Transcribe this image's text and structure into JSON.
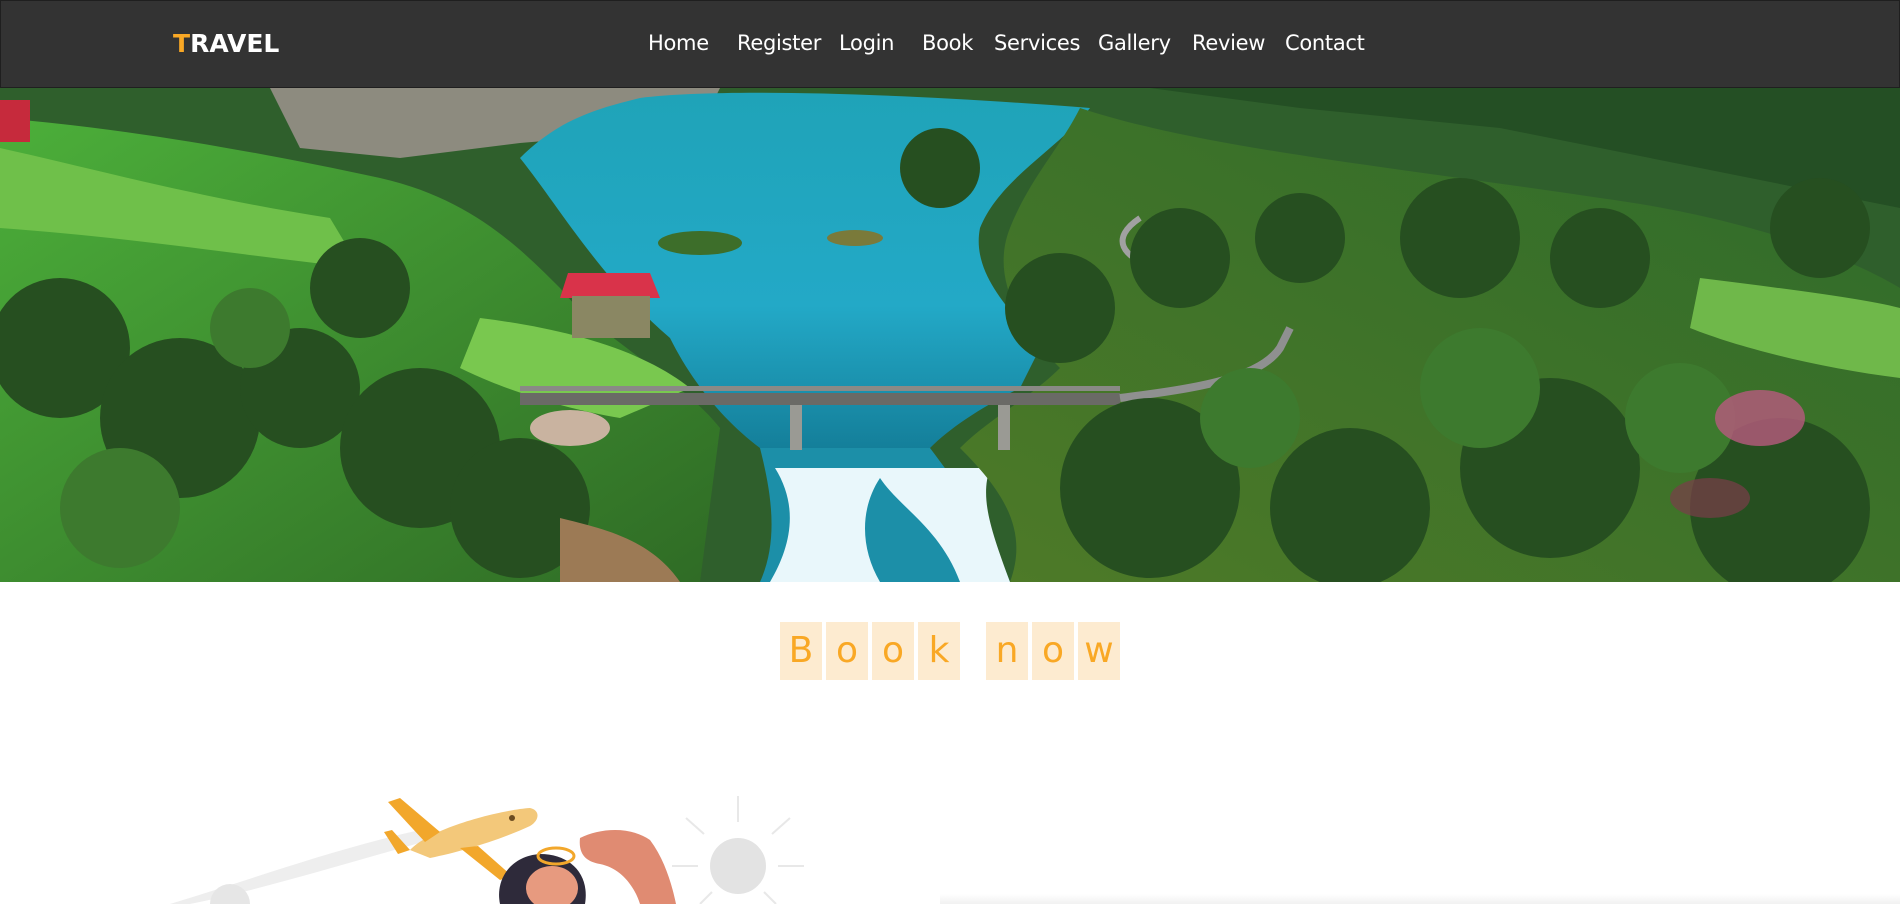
{
  "brand": {
    "first_letter": "T",
    "rest": "RAVEL",
    "accent_color": "#f9a825"
  },
  "nav": {
    "home": "Home",
    "register": "Register",
    "login": "Login",
    "book": "Book",
    "services": "Services",
    "gallery": "Gallery",
    "review": "Review",
    "contact": "Contact"
  },
  "hero": {
    "image": "landscape-photo",
    "subject": "river-bridge-forest"
  },
  "booknow": {
    "word1": [
      "B",
      "o",
      "o",
      "k"
    ],
    "word2": [
      "n",
      "o",
      "w"
    ],
    "text_color": "#f9a825",
    "bg_color": "#fdebd0"
  },
  "illustration": {
    "image": "traveler-airplane-illustration"
  }
}
